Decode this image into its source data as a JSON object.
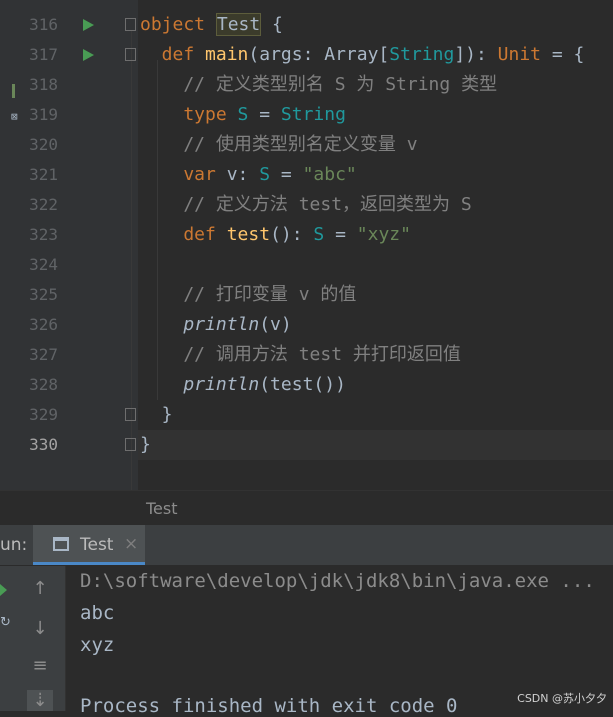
{
  "editor": {
    "lines": [
      {
        "num": "316",
        "parts": [
          {
            "t": "object ",
            "c": "kw"
          },
          {
            "t": "Test",
            "c": "hl"
          },
          {
            "t": " {",
            "c": "ty"
          }
        ]
      },
      {
        "num": "317",
        "parts": [
          {
            "t": "  def ",
            "c": "kw"
          },
          {
            "t": "main",
            "c": "fn"
          },
          {
            "t": "(args: Array[",
            "c": "ty"
          },
          {
            "t": "String",
            "c": "tp"
          },
          {
            "t": "]): ",
            "c": "ty"
          },
          {
            "t": "Unit",
            "c": "kw"
          },
          {
            "t": " = {",
            "c": "ty"
          }
        ]
      },
      {
        "num": "318",
        "parts": [
          {
            "t": "    // 定义类型别名 S 为 String 类型",
            "c": "cm"
          }
        ]
      },
      {
        "num": "319",
        "parts": [
          {
            "t": "    type ",
            "c": "kw"
          },
          {
            "t": "S",
            "c": "tp"
          },
          {
            "t": " = ",
            "c": "ty"
          },
          {
            "t": "String",
            "c": "tp"
          }
        ]
      },
      {
        "num": "320",
        "parts": [
          {
            "t": "    // 使用类型别名定义变量 v",
            "c": "cm"
          }
        ]
      },
      {
        "num": "321",
        "parts": [
          {
            "t": "    var ",
            "c": "kw"
          },
          {
            "t": "v: ",
            "c": "ty"
          },
          {
            "t": "S",
            "c": "tp"
          },
          {
            "t": " = ",
            "c": "ty"
          },
          {
            "t": "\"abc\"",
            "c": "str"
          }
        ]
      },
      {
        "num": "322",
        "parts": [
          {
            "t": "    // 定义方法 test，返回类型为 S",
            "c": "cm"
          }
        ]
      },
      {
        "num": "323",
        "parts": [
          {
            "t": "    def ",
            "c": "kw"
          },
          {
            "t": "test",
            "c": "fn"
          },
          {
            "t": "(): ",
            "c": "ty"
          },
          {
            "t": "S",
            "c": "tp"
          },
          {
            "t": " = ",
            "c": "ty"
          },
          {
            "t": "\"xyz\"",
            "c": "str"
          }
        ]
      },
      {
        "num": "324",
        "parts": []
      },
      {
        "num": "325",
        "parts": [
          {
            "t": "    // 打印变量 v 的值",
            "c": "cm"
          }
        ]
      },
      {
        "num": "326",
        "parts": [
          {
            "t": "    ",
            "c": "ty"
          },
          {
            "t": "println",
            "c": "it"
          },
          {
            "t": "(v)",
            "c": "ty"
          }
        ]
      },
      {
        "num": "327",
        "parts": [
          {
            "t": "    // 调用方法 test 并打印返回值",
            "c": "cm"
          }
        ]
      },
      {
        "num": "328",
        "parts": [
          {
            "t": "    ",
            "c": "ty"
          },
          {
            "t": "println",
            "c": "it"
          },
          {
            "t": "(test())",
            "c": "ty"
          }
        ]
      },
      {
        "num": "329",
        "parts": [
          {
            "t": "  }",
            "c": "ty"
          }
        ]
      },
      {
        "num": "330",
        "parts": [
          {
            "t": "}",
            "c": "ty"
          }
        ]
      }
    ],
    "run_markers": [
      "316",
      "317"
    ],
    "current_line": "330"
  },
  "breadcrumb": {
    "item": "Test"
  },
  "run_panel": {
    "label": "un:",
    "tab_label": "Test",
    "tab_close": "×"
  },
  "console": {
    "path": "D:\\software\\develop\\jdk\\jdk8\\bin\\java.exe ...",
    "out1": "abc",
    "out2": "xyz",
    "exit": "Process finished with exit code 0"
  },
  "watermark": "CSDN @苏小夕夕"
}
